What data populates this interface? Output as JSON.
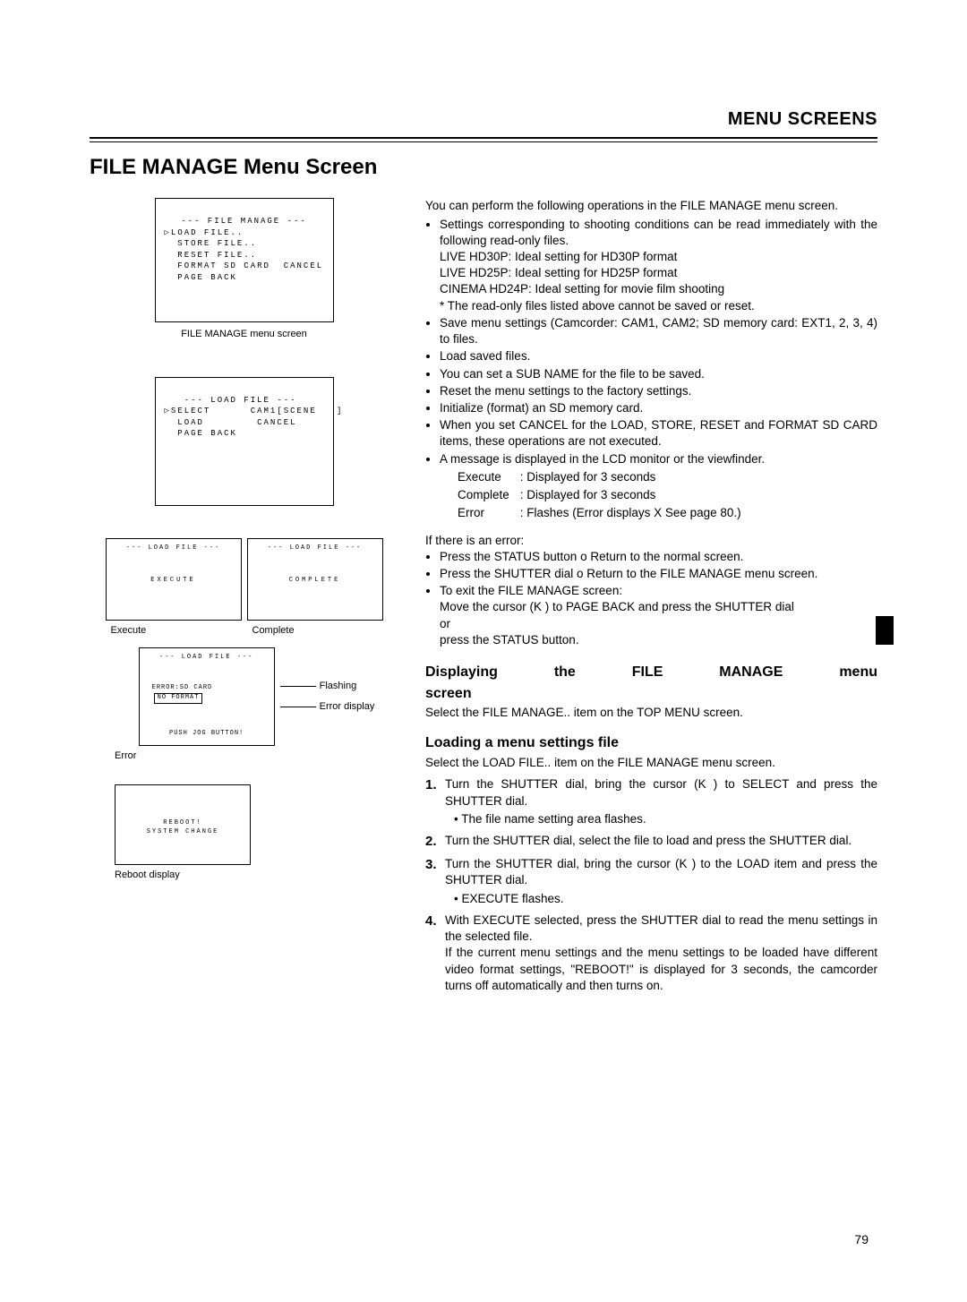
{
  "headerSection": "MENU SCREENS",
  "pageTitle": "FILE MANAGE Menu Screen",
  "pageNumber": "79",
  "screens": {
    "fileManage": {
      "title": "--- FILE MANAGE ---",
      "lines": [
        "▷LOAD FILE..",
        "  STORE FILE..",
        "  RESET FILE..",
        "  FORMAT SD CARD  CANCEL",
        "  PAGE BACK"
      ],
      "caption": "FILE MANAGE menu screen"
    },
    "loadFile": {
      "title": "   --- LOAD FILE ---",
      "lines": [
        "▷SELECT      CAM1[SCENE   ]",
        "  LOAD        CANCEL",
        "  PAGE BACK"
      ],
      "caption": ""
    },
    "execute": {
      "title": "--- LOAD FILE ---",
      "mid": "EXECUTE",
      "caption": "Execute"
    },
    "complete": {
      "title": "--- LOAD FILE ---",
      "mid": "COMPLETE",
      "caption": "Complete"
    },
    "error": {
      "title": "--- LOAD FILE ---",
      "err1": "ERROR:SD CARD",
      "err2": "NO FORMAT",
      "push": "PUSH JOG BUTTON!",
      "calloutFlashing": "Flashing",
      "calloutErrorDisplay": "Error display",
      "caption": "Error"
    },
    "reboot": {
      "line1": "REBOOT!",
      "line2": "SYSTEM CHANGE",
      "caption": "Reboot display"
    }
  },
  "right": {
    "intro": "You can perform the following operations in the FILE MAN­AGE menu screen.",
    "bullets1a": "Settings corresponding to shooting conditions can be read immediately with the following read-only files.",
    "liveHD30": "LIVE HD30P: Ideal setting for HD30P format",
    "liveHD25": "LIVE HD25P: Ideal setting for HD25P format",
    "cinema": "CINEMA HD24P: Ideal setting for movie film shooting",
    "note1": "* The read-only files listed above cannot be saved or reset.",
    "bullet2": "Save menu settings (Camcorder: CAM1, CAM2; SD mem­ory card: EXT1, 2, 3, 4) to files.",
    "bullet3": "Load saved files.",
    "bullet4": "You can set a SUB NAME for the file to be saved.",
    "bullet5": "Reset the menu settings to the factory settings.",
    "bullet6": "Initialize (format) an SD memory card.",
    "bullet7": "When you set CANCEL for the LOAD, STORE, RESET and FORMAT SD CARD items, these operations are not executed.",
    "bullet8": "A message is displayed in the LCD monitor or the view­finder.",
    "msgExecute": {
      "label": "Execute",
      "desc": ": Displayed for 3 seconds"
    },
    "msgComplete": {
      "label": "Complete",
      "desc": ": Displayed for 3 seconds"
    },
    "msgError": {
      "label": "Error",
      "desc": ": Flashes (Error displays X   See page 80.)"
    },
    "errHeading": "If there is an error:",
    "errBullet1": "Press the STATUS button o Return to the normal screen.",
    "errBullet2": "Press the SHUTTER dial o Return to the FILE MAN­AGE menu screen.",
    "exitBullet": "To exit the FILE MANAGE screen:",
    "exitLine1": "Move the cursor (K ) to PAGE BACK and press the SHUT­TER dial",
    "exitOr": "or",
    "exitLine2": "press the STATUS button.",
    "displayHeading": "Displaying the FILE MANAGE menu screen",
    "displayBody": "Select the FILE MANAGE.. item on the TOP MENU screen.",
    "loadHeading": "Loading a menu settings file",
    "loadBody": "Select the LOAD FILE.. item on the FILE MANAGE menu screen.",
    "step1": "Turn the SHUTTER dial, bring the cursor (K ) to SELECT and press the SHUTTER dial.",
    "step1sub": "The file name setting area flashes.",
    "step2": "Turn the SHUTTER dial, select the file to load and press the SHUTTER dial.",
    "step3": "Turn the SHUTTER dial, bring the cursor (K ) to the LOAD item and press the SHUTTER dial.",
    "step3sub": "EXECUTE flashes.",
    "step4a": "With EXECUTE selected, press the SHUTTER dial to read the menu settings in the selected file.",
    "step4b": "If the current menu settings and the menu settings to be loaded have different video format settings, \"REBOOT!\" is displayed for 3 seconds, the camcorder turns off automat­ically and then turns on."
  }
}
